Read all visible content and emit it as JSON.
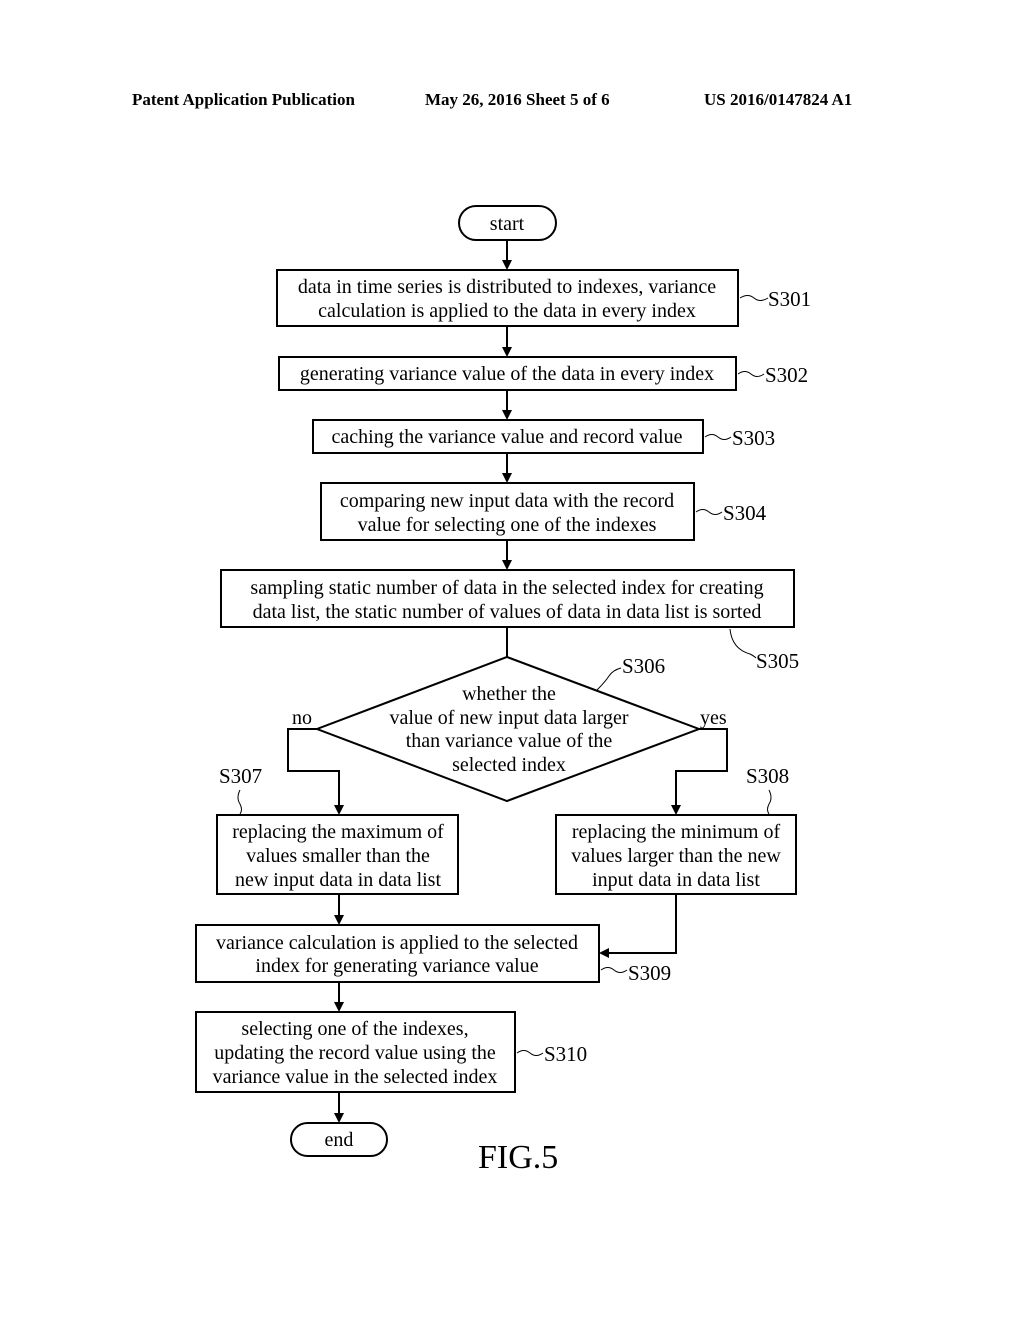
{
  "header": {
    "left": "Patent Application Publication",
    "middle": "May 26, 2016   Sheet 5 of 6",
    "right": "US 2016/0147824 A1"
  },
  "figure_label": "FIG.5",
  "flowchart": {
    "start": "start",
    "end": "end",
    "steps": [
      {
        "id": "S301",
        "lines": [
          "data in time series is distributed to indexes, variance",
          "calculation is applied to the data in every index"
        ]
      },
      {
        "id": "S302",
        "lines": [
          "generating variance value of the data in every index"
        ]
      },
      {
        "id": "S303",
        "lines": [
          "caching the variance value and record value"
        ]
      },
      {
        "id": "S304",
        "lines": [
          "comparing new input data with the record",
          "value for selecting one of the indexes"
        ]
      },
      {
        "id": "S305",
        "lines": [
          "sampling static number of data in the selected index for creating",
          "data list, the static number of values of data in data list is sorted"
        ]
      },
      {
        "id": "S306",
        "lines": [
          "whether the",
          "value of new input data larger",
          "than variance value of the",
          "selected index"
        ]
      },
      {
        "id": "S307",
        "lines": [
          "replacing the maximum of",
          "values smaller than the",
          "new input data in data list"
        ]
      },
      {
        "id": "S308",
        "lines": [
          "replacing the minimum of",
          "values larger than the new",
          "input data in data list"
        ]
      },
      {
        "id": "S309",
        "lines": [
          "variance calculation is applied to the selected",
          "index for generating variance value"
        ]
      },
      {
        "id": "S310",
        "lines": [
          "selecting one of the indexes,",
          "updating the record value using the",
          "variance value in the selected index"
        ]
      }
    ],
    "decision_labels": {
      "no": "no",
      "yes": "yes"
    }
  }
}
